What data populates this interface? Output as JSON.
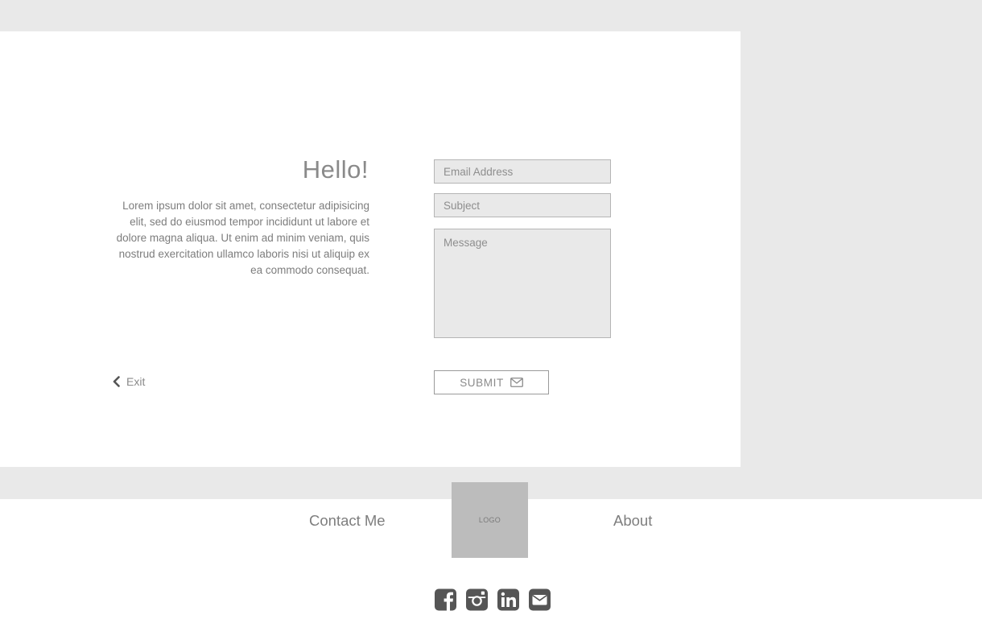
{
  "contact": {
    "heading": "Hello!",
    "intro": "Lorem ipsum dolor sit amet, consectetur adipisicing elit, sed do eiusmod tempor incididunt ut labore et dolore magna aliqua. Ut enim ad minim veniam, quis nostrud exercitation ullamco laboris nisi ut aliquip ex ea commodo consequat.",
    "email_placeholder": "Email Address",
    "subject_placeholder": "Subject",
    "message_placeholder": "Message",
    "submit_label": "SUBMIT",
    "exit_label": "Exit"
  },
  "footer": {
    "nav_left": "Contact Me",
    "nav_right": "About",
    "logo_text": "LOGO",
    "social_icons": [
      "facebook-icon",
      "instagram-icon",
      "linkedin-icon",
      "envelope-icon"
    ]
  },
  "colors": {
    "background": "#e9e9e9",
    "card": "#ffffff",
    "field_fill": "#e9e9e9",
    "logo_fill": "#bcbcbc",
    "icon": "#555555"
  }
}
